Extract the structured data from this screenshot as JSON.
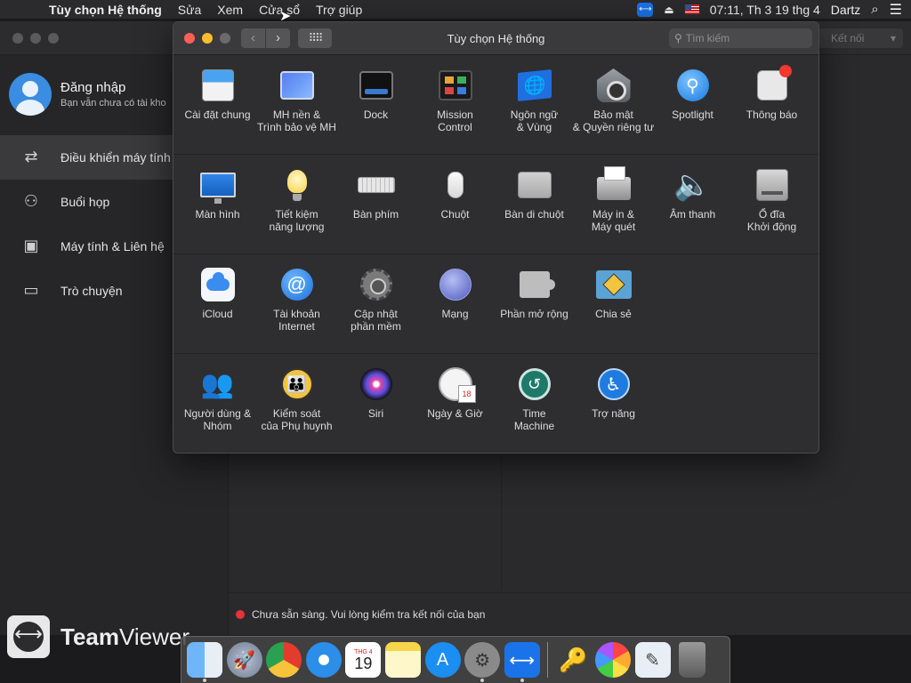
{
  "menubar": {
    "apple": "",
    "app_name": "Tùy chọn Hệ thống",
    "menus": [
      "Sửa",
      "Xem",
      "Cửa sổ",
      "Trợ giúp"
    ],
    "clock": "07:11, Th 3 19 thg 4",
    "user": "Dartz"
  },
  "teamviewer": {
    "signin_title": "Đăng nhập",
    "signin_sub": "Bạn vẫn chưa có tài kho",
    "nav": [
      {
        "label": "Điều khiển máy tính t",
        "icon": "arrows-icon",
        "active": true
      },
      {
        "label": "Buổi họp",
        "icon": "people-icon",
        "active": false
      },
      {
        "label": "Máy tính & Liên hệ",
        "icon": "contacts-icon",
        "active": false
      },
      {
        "label": "Trò chuyện",
        "icon": "chat-icon",
        "active": false
      }
    ],
    "brand_bold": "Team",
    "brand_rest": "Viewer",
    "connect_label": "Kết nối",
    "status": "Chưa sẵn sàng. Vui lòng kiểm tra kết nối của bạn"
  },
  "prefs": {
    "title": "Tùy chọn Hệ thống",
    "search_placeholder": "Tìm kiếm",
    "rows": [
      [
        {
          "label": "Cài đặt chung",
          "icon": "general-icon"
        },
        {
          "label": "MH nền &\nTrình bảo vệ MH",
          "icon": "desktop-icon"
        },
        {
          "label": "Dock",
          "icon": "dock-icon"
        },
        {
          "label": "Mission\nControl",
          "icon": "mission-control-icon"
        },
        {
          "label": "Ngôn ngữ\n& Vùng",
          "icon": "language-icon"
        },
        {
          "label": "Bảo mật\n& Quyền riêng tư",
          "icon": "security-icon"
        },
        {
          "label": "Spotlight",
          "icon": "spotlight-icon"
        },
        {
          "label": "Thông báo",
          "icon": "notifications-icon"
        }
      ],
      [
        {
          "label": "Màn hình",
          "icon": "display-icon"
        },
        {
          "label": "Tiết kiệm\nnăng lượng",
          "icon": "energy-icon"
        },
        {
          "label": "Bàn phím",
          "icon": "keyboard-icon"
        },
        {
          "label": "Chuột",
          "icon": "mouse-icon"
        },
        {
          "label": "Bàn di chuột",
          "icon": "trackpad-icon"
        },
        {
          "label": "Máy in &\nMáy quét",
          "icon": "printer-icon"
        },
        {
          "label": "Âm thanh",
          "icon": "sound-icon"
        },
        {
          "label": "Ổ đĩa\nKhởi động",
          "icon": "startup-disk-icon"
        }
      ],
      [
        {
          "label": "iCloud",
          "icon": "icloud-icon"
        },
        {
          "label": "Tài khoản\nInternet",
          "icon": "internet-accounts-icon"
        },
        {
          "label": "Cập nhật\nphần mềm",
          "icon": "software-update-icon"
        },
        {
          "label": "Mạng",
          "icon": "network-icon"
        },
        {
          "label": "Phần mở rộng",
          "icon": "extensions-icon"
        },
        {
          "label": "Chia sẻ",
          "icon": "sharing-icon"
        }
      ],
      [
        {
          "label": "Người dùng &\nNhóm",
          "icon": "users-icon"
        },
        {
          "label": "Kiểm soát\ncủa Phụ huynh",
          "icon": "parental-controls-icon"
        },
        {
          "label": "Siri",
          "icon": "siri-icon"
        },
        {
          "label": "Ngày & Giờ",
          "icon": "date-time-icon"
        },
        {
          "label": "Time\nMachine",
          "icon": "time-machine-icon"
        },
        {
          "label": "Trợ năng",
          "icon": "accessibility-icon"
        }
      ]
    ]
  },
  "dock": {
    "calendar_month": "THG 4",
    "calendar_day": "19",
    "apps": [
      "finder-icon",
      "launchpad-icon",
      "chrome-icon",
      "safari-icon",
      "calendar-icon",
      "notes-icon",
      "app-store-icon",
      "system-preferences-icon",
      "teamviewer-icon",
      "keychain-icon",
      "photos-icon",
      "preview-icon",
      "trash-icon"
    ]
  },
  "colors": {
    "close": "#fc5f57",
    "minimize": "#fdbc2e",
    "accent": "#1a73e8",
    "status_red": "#e5343a"
  }
}
